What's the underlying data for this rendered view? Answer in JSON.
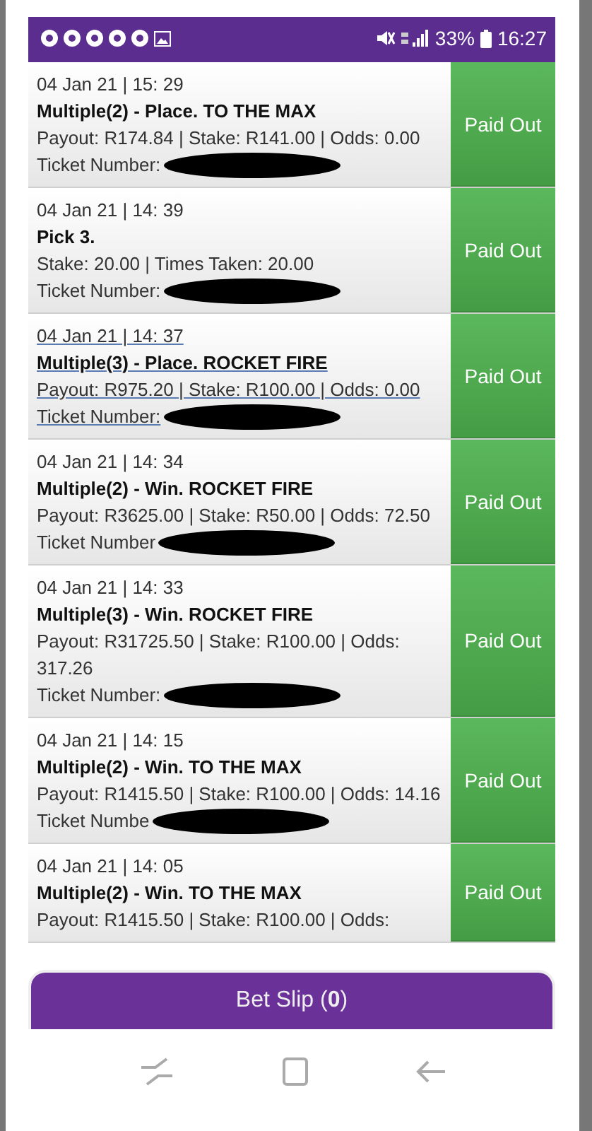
{
  "status_bar": {
    "battery": "33%",
    "time": "16:27"
  },
  "bets": [
    {
      "date": "04 Jan 21 | 15: 29",
      "title": "Multiple(2) - Place. TO THE MAX",
      "details": "Payout: R174.84 | Stake: R141.00 | Odds: 0.00",
      "ticket_label": "Ticket Number:",
      "status": "Paid Out",
      "selected": false
    },
    {
      "date": "04 Jan 21 | 14: 39",
      "title": "Pick 3.",
      "details": "Stake: 20.00 | Times Taken: 20.00",
      "ticket_label": "Ticket Number:",
      "status": "Paid Out",
      "selected": false
    },
    {
      "date": "04 Jan 21 | 14: 37",
      "title": "Multiple(3) - Place. ROCKET FIRE",
      "details": "Payout: R975.20 | Stake: R100.00 | Odds: 0.00",
      "ticket_label": "Ticket Number:",
      "status": "Paid Out",
      "selected": true
    },
    {
      "date": "04 Jan 21 | 14: 34",
      "title": "Multiple(2) - Win. ROCKET FIRE",
      "details": "Payout: R3625.00 | Stake: R50.00 | Odds: 72.50",
      "ticket_label": "Ticket Number",
      "status": "Paid Out",
      "selected": false
    },
    {
      "date": "04 Jan 21 | 14: 33",
      "title": "Multiple(3) - Win. ROCKET FIRE",
      "details": "Payout: R31725.50 | Stake: R100.00 | Odds: 317.26",
      "ticket_label": "Ticket Number:",
      "status": "Paid Out",
      "selected": false
    },
    {
      "date": "04 Jan 21 | 14: 15",
      "title": "Multiple(2) - Win. TO THE MAX",
      "details": "Payout: R1415.50 | Stake: R100.00 | Odds: 14.16",
      "ticket_label": "Ticket Numbe",
      "status": "Paid Out",
      "selected": false
    },
    {
      "date": "04 Jan 21 | 14: 05",
      "title": "Multiple(2) - Win. TO THE MAX",
      "details": "Payout: R1415.50 | Stake: R100.00 | Odds:",
      "status": "Paid Out",
      "selected": false
    }
  ],
  "bet_slip": {
    "label": "Bet Slip (**0**)"
  }
}
